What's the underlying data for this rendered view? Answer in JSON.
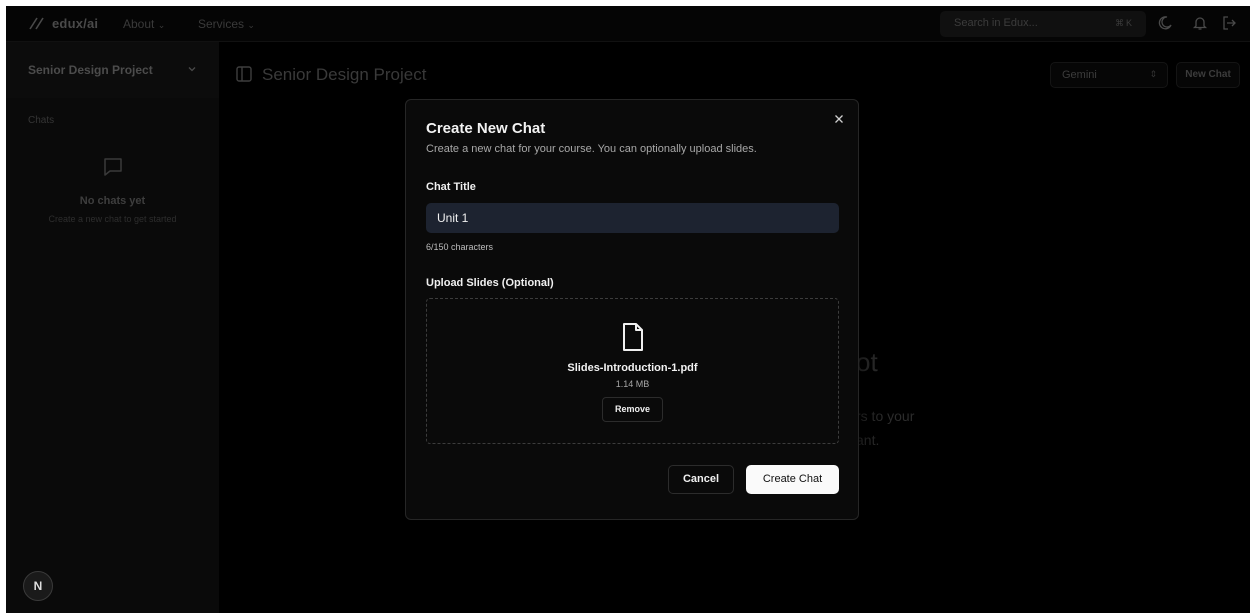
{
  "nav": {
    "logo_text": "edux/ai",
    "about_label": "About",
    "services_label": "Services",
    "search_placeholder": "Search in Edux...",
    "shortcut": "⌘K"
  },
  "sidebar": {
    "project_name": "Senior Design Project",
    "chats_label": "Chats",
    "empty_title": "No chats yet",
    "empty_subtitle": "Create a new chat to get started",
    "avatar_letter": "N"
  },
  "main": {
    "title": "Senior Design Project",
    "model": "Gemini",
    "new_chat_label": "New Chat",
    "bg_fragment_1": "ot",
    "bg_fragment_2": "rs to your",
    "bg_fragment_3": "ant."
  },
  "modal": {
    "title": "Create New Chat",
    "description": "Create a new chat for your course. You can optionally upload slides.",
    "chat_title_label": "Chat Title",
    "chat_title_value": "Unit 1",
    "char_counter": "6/150 characters",
    "upload_label": "Upload Slides (Optional)",
    "file_name": "Slides-Introduction-1.pdf",
    "file_size": "1.14 MB",
    "remove_label": "Remove",
    "cancel_label": "Cancel",
    "create_label": "Create Chat"
  }
}
